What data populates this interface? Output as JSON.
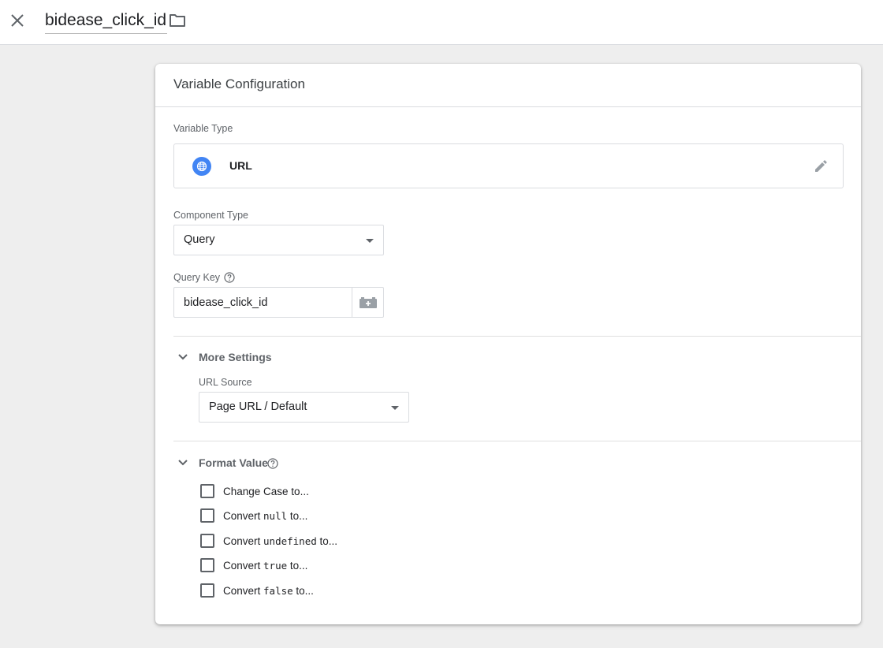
{
  "header": {
    "variable_name": "bidease_click_id"
  },
  "card": {
    "title": "Variable Configuration",
    "variable_type": {
      "label": "Variable Type",
      "name": "URL",
      "icon": "globe-icon",
      "accent_color": "#4285f4"
    },
    "component_type": {
      "label": "Component Type",
      "value": "Query"
    },
    "query_key": {
      "label": "Query Key",
      "value": "bidease_click_id"
    },
    "more_settings": {
      "title": "More Settings",
      "url_source": {
        "label": "URL Source",
        "value": "Page URL / Default"
      }
    },
    "format_value": {
      "title": "Format Value",
      "options": [
        {
          "prefix": "Change Case to...",
          "code": "",
          "suffix": "",
          "checked": false
        },
        {
          "prefix": "Convert ",
          "code": "null",
          "suffix": " to...",
          "checked": false
        },
        {
          "prefix": "Convert ",
          "code": "undefined",
          "suffix": " to...",
          "checked": false
        },
        {
          "prefix": "Convert ",
          "code": "true",
          "suffix": " to...",
          "checked": false
        },
        {
          "prefix": "Convert ",
          "code": "false",
          "suffix": " to...",
          "checked": false
        }
      ]
    }
  }
}
